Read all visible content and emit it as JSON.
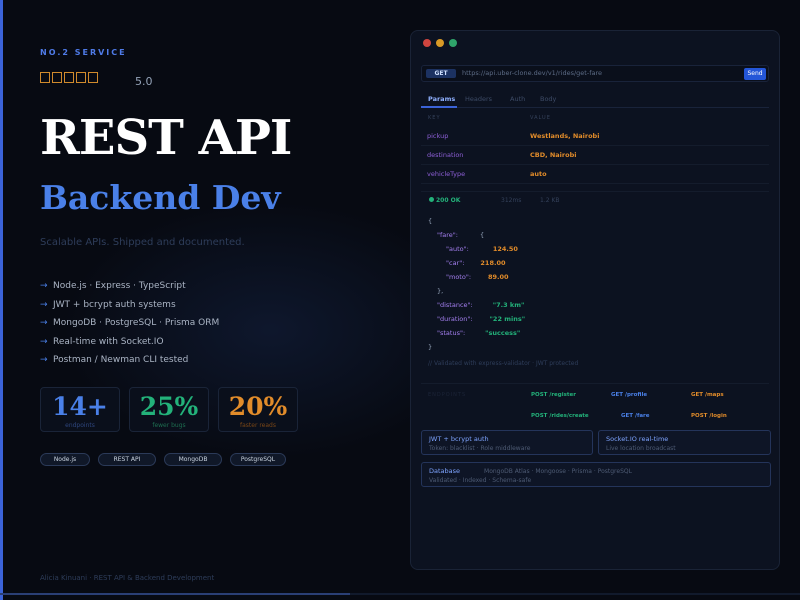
{
  "hero": {
    "eyebrow": "NO.2 SERVICE",
    "rating": "5.0",
    "title": "REST API",
    "subtitle": "Backend Dev",
    "tagline": "Scalable APIs. Shipped and documented.",
    "arrow": "→"
  },
  "features": [
    "Node.js · Express · TypeScript",
    "JWT + bcrypt auth systems",
    "MongoDB · PostgreSQL · Prisma ORM",
    "Real-time with Socket.IO",
    "Postman / Newman CLI tested"
  ],
  "stats": [
    {
      "value": "14+",
      "label": "endpoints"
    },
    {
      "value": "25%",
      "label": "fewer bugs"
    },
    {
      "value": "20%",
      "label": "faster reads"
    }
  ],
  "chips": [
    "Node.js",
    "REST API",
    "MongoDB",
    "PostgreSQL"
  ],
  "footer": "Alicia Kinuani · REST API & Backend Development",
  "client": {
    "method": "GET",
    "url": "https://api.uber-clone.dev/v1/rides/get-fare",
    "send": "Send",
    "tabs": [
      "Params",
      "Headers",
      "Auth",
      "Body"
    ],
    "params_header": {
      "key": "KEY",
      "value": "VALUE"
    },
    "params": [
      {
        "key": "pickup",
        "value": "Westlands, Nairobi"
      },
      {
        "key": "destination",
        "value": "CBD, Nairobi"
      },
      {
        "key": "vehicleType",
        "value": "auto"
      }
    ],
    "response": {
      "status": "200 OK",
      "time": "312ms",
      "size": "1.2 KB",
      "body": {
        "open": "{",
        "fare_key": "\"fare\":",
        "fare_open": "{",
        "auto_key": "\"auto\":",
        "auto_val": "124.50",
        "car_key": "\"car\":",
        "car_val": "218.00",
        "moto_key": "\"moto\":",
        "moto_val": "89.00",
        "fare_close": "},",
        "distance_key": "\"distance\":",
        "distance_val": "\"7.3 km\"",
        "duration_key": "\"duration\":",
        "duration_val": "\"22 mins\"",
        "status_key": "\"status\":",
        "status_val": "\"success\"",
        "close": "}"
      },
      "note": "// Validated with express-validator · JWT protected"
    },
    "endpoints_label": "ENDPOINTS",
    "endpoints": [
      [
        "POST /register",
        "GET /profile",
        "GET /maps"
      ],
      [
        "POST /rides/create",
        "GET /fare",
        "POST /login"
      ]
    ],
    "cards": {
      "auth": {
        "title": "JWT + bcrypt auth",
        "desc": "Token: blacklist · Role middleware"
      },
      "socket": {
        "title": "Socket.IO real-time",
        "desc": "Live location broadcast"
      },
      "db": {
        "title": "Database",
        "stack": "MongoDB Atlas · Mongoose · Prisma · PostgreSQL",
        "desc": "Validated · Indexed · Schema-safe"
      }
    }
  },
  "colors": {
    "accent": "#4a80e8",
    "green": "#23b27a",
    "orange": "#e28c2a",
    "purple": "#8d5fd6"
  }
}
